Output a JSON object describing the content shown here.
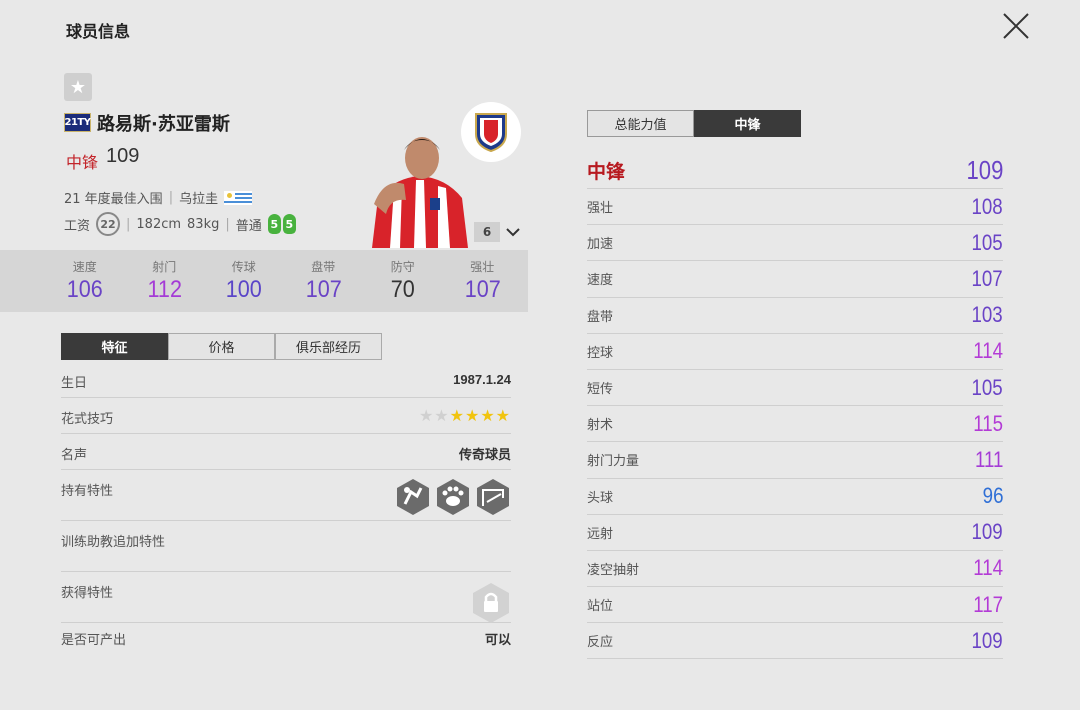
{
  "header": {
    "title": "球员信息",
    "close_icon": "close-icon"
  },
  "player": {
    "season": "21TY",
    "name": "路易斯·苏亚雷斯",
    "position": "中锋",
    "position_ovr": "109",
    "season_desc": "21 年度最佳入围",
    "nation": "乌拉圭",
    "salary_label": "工资",
    "salary": "22",
    "height": "182cm",
    "weight": "83kg",
    "body_type": "普通",
    "left_foot": "5",
    "right_foot": "5",
    "level": "6"
  },
  "stats": [
    {
      "label": "速度",
      "value": "106",
      "color": "#6a43c6"
    },
    {
      "label": "射门",
      "value": "112",
      "color": "#a43bd6"
    },
    {
      "label": "传球",
      "value": "100",
      "color": "#5a45c8"
    },
    {
      "label": "盘带",
      "value": "107",
      "color": "#6a43c6"
    },
    {
      "label": "防守",
      "value": "70",
      "color": "#333333"
    },
    {
      "label": "强壮",
      "value": "107",
      "color": "#6a43c6"
    }
  ],
  "tabs": [
    "特征",
    "价格",
    "俱乐部经历"
  ],
  "info": {
    "birthday_label": "生日",
    "birthday": "1987.1.24",
    "skill_label": "花式技巧",
    "skill_stars": 4,
    "fame_label": "名声",
    "fame": "传奇球员",
    "traits_label": "持有特性",
    "coach_label": "训练助教追加特性",
    "acquire_label": "获得特性",
    "produce_label": "是否可产出",
    "produce": "可以"
  },
  "position_tabs": [
    "总能力值",
    "中锋"
  ],
  "position_detail": {
    "title": "中锋",
    "value": "109",
    "rows": [
      {
        "name": "强壮",
        "value": "108",
        "color": "#6a43c6"
      },
      {
        "name": "加速",
        "value": "105",
        "color": "#6a43c6"
      },
      {
        "name": "速度",
        "value": "107",
        "color": "#6a43c6"
      },
      {
        "name": "盘带",
        "value": "103",
        "color": "#6a43c6"
      },
      {
        "name": "控球",
        "value": "114",
        "color": "#b33bd6"
      },
      {
        "name": "短传",
        "value": "105",
        "color": "#6a43c6"
      },
      {
        "name": "射术",
        "value": "115",
        "color": "#b33bd6"
      },
      {
        "name": "射门力量",
        "value": "111",
        "color": "#a43bd6"
      },
      {
        "name": "头球",
        "value": "96",
        "color": "#2f6fd6"
      },
      {
        "name": "远射",
        "value": "109",
        "color": "#6a43c6"
      },
      {
        "name": "凌空抽射",
        "value": "114",
        "color": "#b33bd6"
      },
      {
        "name": "站位",
        "value": "117",
        "color": "#b33bd6"
      },
      {
        "name": "反应",
        "value": "109",
        "color": "#6a43c6"
      }
    ]
  }
}
